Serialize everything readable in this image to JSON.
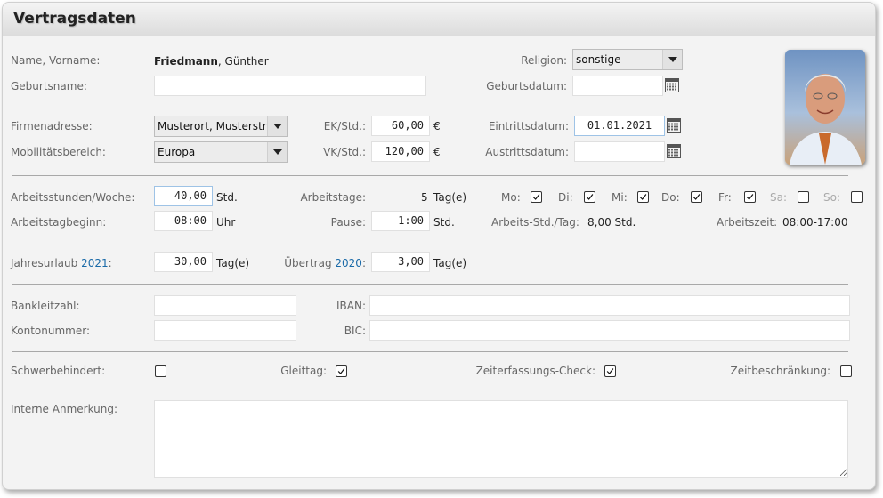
{
  "panel": {
    "title": "Vertragsdaten"
  },
  "person": {
    "name_label": "Name, Vorname:",
    "last_name": "Friedmann",
    "first_name": ", Günther",
    "birthname_label": "Geburtsname:",
    "birthname_value": "",
    "religion_label": "Religion:",
    "religion_value": "sonstige",
    "birthdate_label": "Geburtsdatum:",
    "birthdate_value": ""
  },
  "company": {
    "address_label": "Firmenadresse:",
    "address_value": "Musterort, Musterstr",
    "mobility_label": "Mobilitätsbereich:",
    "mobility_value": "Europa",
    "ek_label": "EK/Std.:",
    "ek_value": "60,00",
    "vk_label": "VK/Std.:",
    "vk_value": "120,00",
    "currency": "€",
    "entry_label": "Eintrittsdatum:",
    "entry_value": "01.01.2021",
    "exit_label": "Austrittsdatum:",
    "exit_value": ""
  },
  "work": {
    "hours_label": "Arbeitsstunden/Woche:",
    "hours_value": "40,00",
    "hours_unit": "Std.",
    "days_label": "Arbeitstage:",
    "days_value": "5",
    "days_unit": "Tag(e)",
    "weekdays": [
      {
        "label": "Mo:",
        "checked": true
      },
      {
        "label": "Di:",
        "checked": true
      },
      {
        "label": "Mi:",
        "checked": true
      },
      {
        "label": "Do:",
        "checked": true
      },
      {
        "label": "Fr:",
        "checked": true
      },
      {
        "label": "Sa:",
        "checked": false
      },
      {
        "label": "So:",
        "checked": false
      }
    ],
    "start_label": "Arbeitstagbeginn:",
    "start_value": "08:00",
    "start_unit": "Uhr",
    "break_label": "Pause:",
    "break_value": "1:00",
    "break_unit": "Std.",
    "perday_label": "Arbeits-Std./Tag:",
    "perday_value": "8,00 Std.",
    "worktime_label": "Arbeitszeit:",
    "worktime_value": "08:00-17:00"
  },
  "vacation": {
    "label_prefix": "Jahresurlaub",
    "year": "2021",
    "label_suffix": ":",
    "value": "30,00",
    "unit": "Tag(e)",
    "carry_prefix": "Übertrag",
    "carry_year": "2020",
    "carry_suffix": ":",
    "carry_value": "3,00",
    "carry_unit": "Tag(e)"
  },
  "bank": {
    "blz_label": "Bankleitzahl:",
    "blz_value": "",
    "account_label": "Kontonummer:",
    "account_value": "",
    "iban_label": "IBAN:",
    "iban_value": "",
    "bic_label": "BIC:",
    "bic_value": ""
  },
  "flags": {
    "disabled_label": "Schwerbehindert:",
    "disabled_checked": false,
    "flextime_label": "Gleittag:",
    "flextime_checked": true,
    "check_label": "Zeiterfassungs-Check:",
    "check_checked": true,
    "limit_label": "Zeitbeschränkung:",
    "limit_checked": false
  },
  "notes": {
    "label": "Interne Anmerkung:",
    "value": ""
  },
  "icons": {
    "dropdown": "chevron-down-icon",
    "calendar": "calendar-icon",
    "checkbox": "checkmark-icon"
  },
  "colors": {
    "link_blue": "#1a6aa8",
    "panel_bg": "#f3f3f3"
  }
}
